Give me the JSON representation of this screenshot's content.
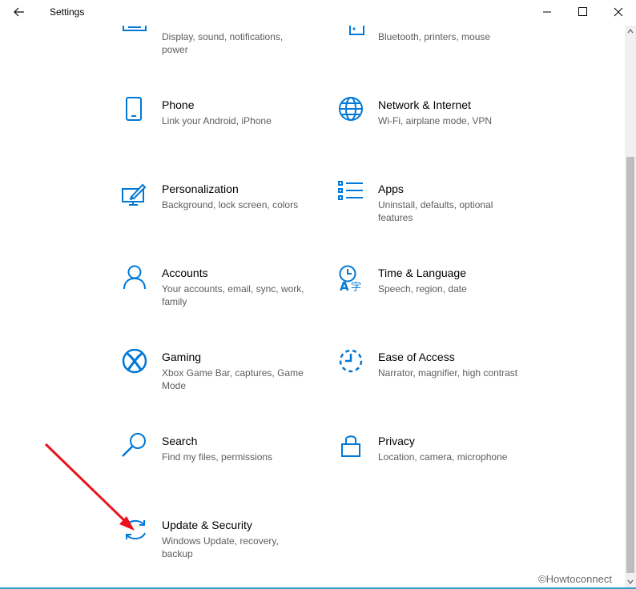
{
  "window": {
    "title": "Settings",
    "accent_color": "#0078d7",
    "back_icon": "arrow-left-icon",
    "minimize_icon": "minimize-icon",
    "maximize_icon": "maximize-icon",
    "close_icon": "close-icon"
  },
  "tiles": {
    "system": {
      "desc": "Display, sound, notifications, power",
      "icon": "system-display-icon"
    },
    "devices": {
      "desc": "Bluetooth, printers, mouse",
      "icon": "devices-keyboard-icon"
    },
    "phone": {
      "name": "Phone",
      "desc": "Link your Android, iPhone",
      "icon": "phone-icon"
    },
    "network": {
      "name": "Network & Internet",
      "desc": "Wi-Fi, airplane mode, VPN",
      "icon": "globe-icon"
    },
    "personalization": {
      "name": "Personalization",
      "desc": "Background, lock screen, colors",
      "icon": "paint-brush-icon"
    },
    "apps": {
      "name": "Apps",
      "desc": "Uninstall, defaults, optional features",
      "icon": "apps-list-icon"
    },
    "accounts": {
      "name": "Accounts",
      "desc": "Your accounts, email, sync, work, family",
      "icon": "person-icon"
    },
    "time_language": {
      "name": "Time & Language",
      "desc": "Speech, region, date",
      "icon": "clock-language-icon"
    },
    "gaming": {
      "name": "Gaming",
      "desc": "Xbox Game Bar, captures, Game Mode",
      "icon": "xbox-icon"
    },
    "ease_of_access": {
      "name": "Ease of Access",
      "desc": "Narrator, magnifier, high contrast",
      "icon": "ease-of-access-icon"
    },
    "search": {
      "name": "Search",
      "desc": "Find my files, permissions",
      "icon": "search-icon"
    },
    "privacy": {
      "name": "Privacy",
      "desc": "Location, camera, microphone",
      "icon": "lock-icon"
    },
    "update_security": {
      "name": "Update & Security",
      "desc": "Windows Update, recovery, backup",
      "icon": "sync-arrows-icon"
    }
  },
  "watermark": "©Howtoconnect",
  "annotation": {
    "color": "#e8141b",
    "icon": "red-arrow-annotation"
  }
}
